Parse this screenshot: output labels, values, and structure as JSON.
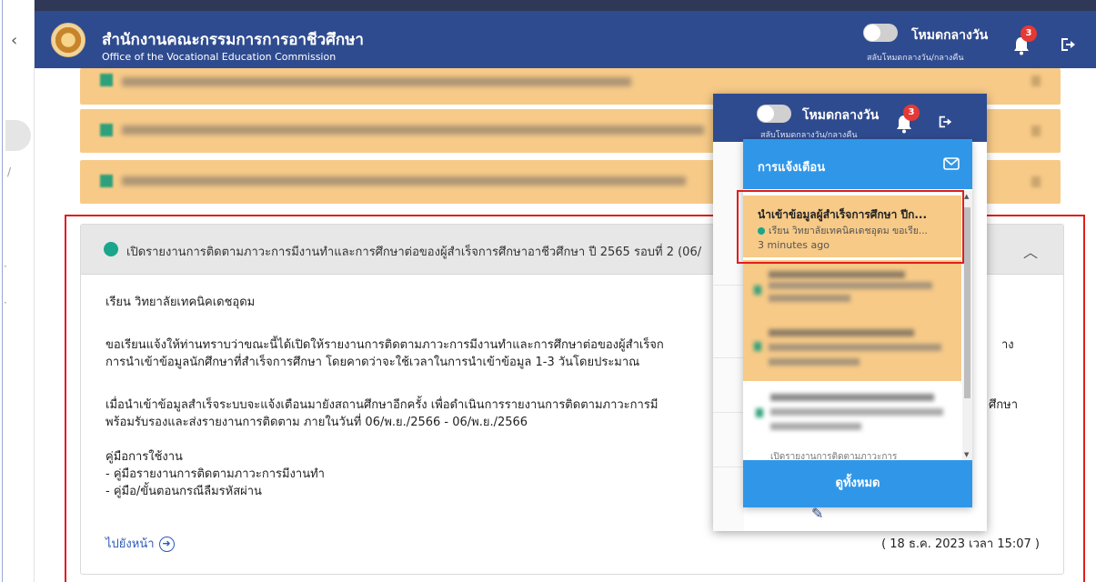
{
  "header": {
    "title": "สำนักงานคณะกรรมการการอาชีวศึกษา",
    "subtitle": "Office of the Vocational Education Commission",
    "mode_label": "โหมดกลางวัน",
    "mode_sub": "สลับโหมดกลางวัน/กลางคืน",
    "notif_count": "3"
  },
  "card": {
    "header_text": "เปิดรายงานการติดตามภาวะการมีงานทำและการศึกษาต่อของผู้สำเร็จการศึกษาอาชีวศึกษา ปี 2565 รอบที่ 2 (06/",
    "greeting": "เรียน วิทยาลัยเทคนิคเดชอุดม",
    "p1_line1": "ขอเรียนแจ้งให้ท่านทราบว่าขณะนี้ได้เปิดให้รายงานการติดตามภาวะการมีงานทำและการศึกษาต่อของผู้สำเร็จก",
    "p1_line1_end": "าง",
    "p1_line2": "การนำเข้าข้อมูลนักศึกษาที่สำเร็จการศึกษา โดยคาดว่าจะใช้เวลาในการนำเข้าข้อมูล 1-3 วันโดยประมาณ",
    "p2_line1": "เมื่อนำเข้าข้อมูลสำเร็จระบบจะแจ้งเตือนมายังสถานศึกษาอีกครั้ง เพื่อดำเนินการรายงานการติดตามภาวะการมี",
    "p2_line1_end": "ศึกษา",
    "p2_line2": "พร้อมรับรองและส่งรายงานการติดตาม ภายในวันที่ 06/พ.ย./2566 - 06/พ.ย./2566",
    "manual_title": "คู่มือการใช้งาน",
    "manual_1": "- คู่มือรายงานการติดตามภาวะการมีงานทำ",
    "manual_2": "- คู่มือ/ขั้นตอนกรณีลืมรหัสผ่าน",
    "go_link": "ไปยังหน้า",
    "date": "( 18 ธ.ค. 2023 เวลา 15:07 )"
  },
  "notifications": {
    "title": "การแจ้งเตือน",
    "item_title": "นำเข้าข้อมูลผู้สำเร็จการศึกษา ปีก...",
    "item_sub": "เรียน วิทยาลัยเทคนิคเดชอุดม ขอเรีย...",
    "item_time": "3 minutes ago",
    "partial_item": "เปิดรายงานการติดตามภาวะการ",
    "view_all": "ดูทั้งหมด"
  },
  "colors": {
    "header_bg": "#2f4b8f",
    "notif_blue": "#3097e8",
    "highlight_orange": "#f7ca88",
    "highlight_red": "#e11d1d",
    "status_green": "#1aa68a"
  },
  "icons": [
    "chevron-left-icon",
    "bell-icon",
    "logout-icon",
    "mail-icon",
    "arrow-circle-right-icon",
    "chevron-up-icon",
    "pencil-icon"
  ]
}
